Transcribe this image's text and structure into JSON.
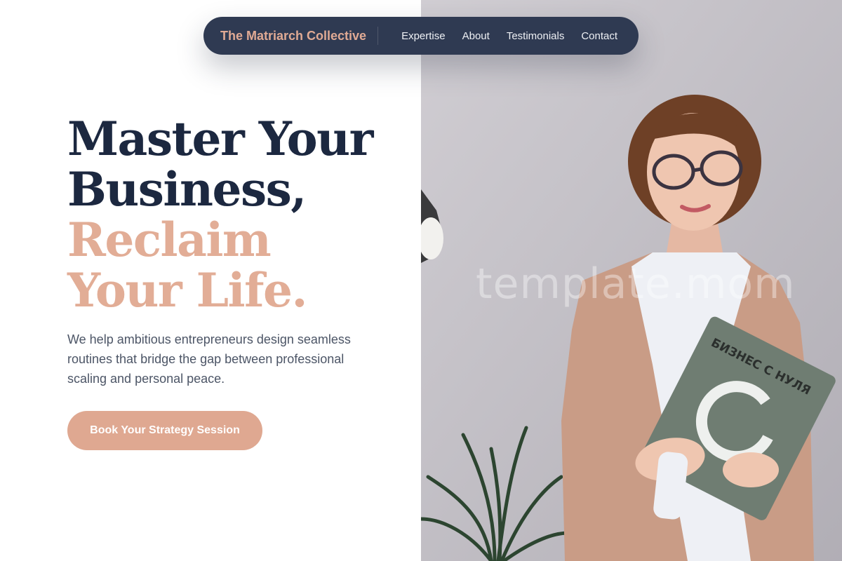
{
  "nav": {
    "brand": "The Matriarch Collective",
    "links": [
      "Expertise",
      "About",
      "Testimonials",
      "Contact"
    ]
  },
  "hero": {
    "headline_line1": "Master Your",
    "headline_line2": "Business,",
    "headline_line3": "Reclaim",
    "headline_line4": "Your Life.",
    "subtitle": "We help ambitious entrepreneurs design seamless routines that bridge the gap between professional scaling and personal peace.",
    "cta_label": "Book Your Strategy Session"
  },
  "photo": {
    "watermark": "template.mom",
    "book_title": "БИЗНЕС С НУЛЯ"
  },
  "colors": {
    "navy": "#1c2840",
    "nav_bg": "#2f3a52",
    "accent": "#dfa891",
    "body_text": "#4c5566"
  }
}
